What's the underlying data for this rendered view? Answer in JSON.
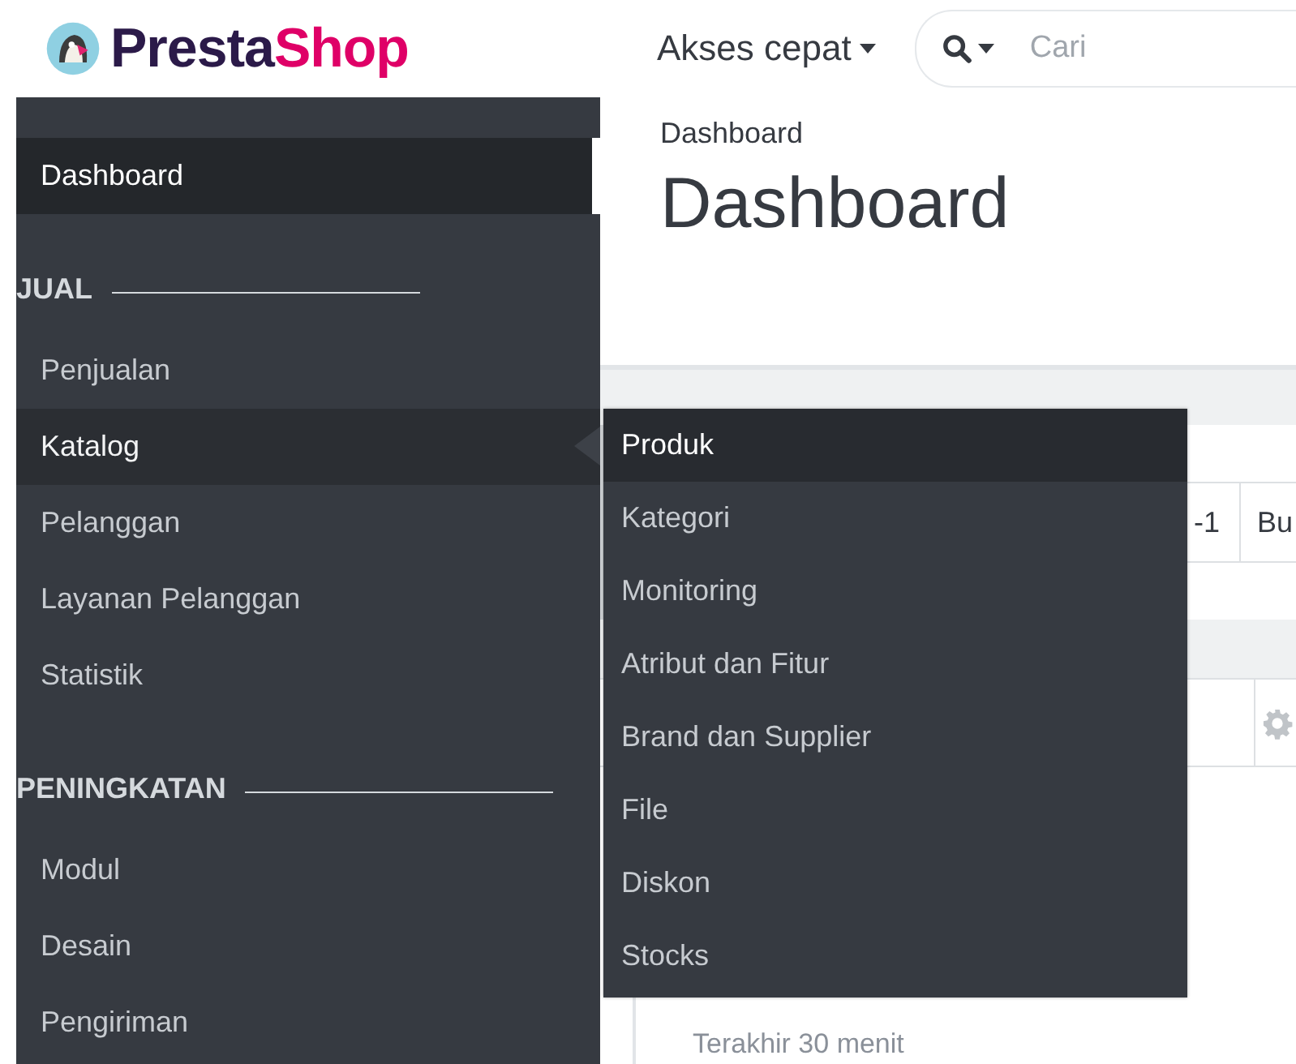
{
  "header": {
    "logo": {
      "part_1": "Presta",
      "part_2": "Shop"
    },
    "quick_access": "Akses cepat",
    "search": {
      "placeholder": "Cari"
    }
  },
  "sidebar": {
    "items": [
      {
        "kind": "link",
        "label": "Dashboard",
        "selected": true,
        "expanded": false
      },
      {
        "kind": "section",
        "label": "JUAL"
      },
      {
        "kind": "link",
        "label": "Penjualan",
        "selected": false,
        "expanded": false
      },
      {
        "kind": "link",
        "label": "Katalog",
        "selected": false,
        "expanded": true,
        "children": [
          {
            "label": "Produk",
            "selected": true
          },
          {
            "label": "Kategori",
            "selected": false
          },
          {
            "label": "Monitoring",
            "selected": false
          },
          {
            "label": "Atribut dan Fitur",
            "selected": false
          },
          {
            "label": "Brand dan Supplier",
            "selected": false
          },
          {
            "label": "File",
            "selected": false
          },
          {
            "label": "Diskon",
            "selected": false
          },
          {
            "label": "Stocks",
            "selected": false
          }
        ]
      },
      {
        "kind": "link",
        "label": "Pelanggan",
        "selected": false,
        "expanded": false
      },
      {
        "kind": "link",
        "label": "Layanan Pelanggan",
        "selected": false,
        "expanded": false
      },
      {
        "kind": "link",
        "label": "Statistik",
        "selected": false,
        "expanded": false
      },
      {
        "kind": "section",
        "label": "PENINGKATAN"
      },
      {
        "kind": "link",
        "label": "Modul",
        "selected": false,
        "expanded": false
      },
      {
        "kind": "link",
        "label": "Desain",
        "selected": false,
        "expanded": false
      },
      {
        "kind": "link",
        "label": "Pengiriman",
        "selected": false,
        "expanded": false
      }
    ]
  },
  "content": {
    "breadcrumb": "Dashboard",
    "title": "Dashboard",
    "toolbar": {
      "cells": [
        "-1",
        "Bu"
      ]
    },
    "panel": {
      "subtitle": "Terakhir 30 menit"
    }
  }
}
